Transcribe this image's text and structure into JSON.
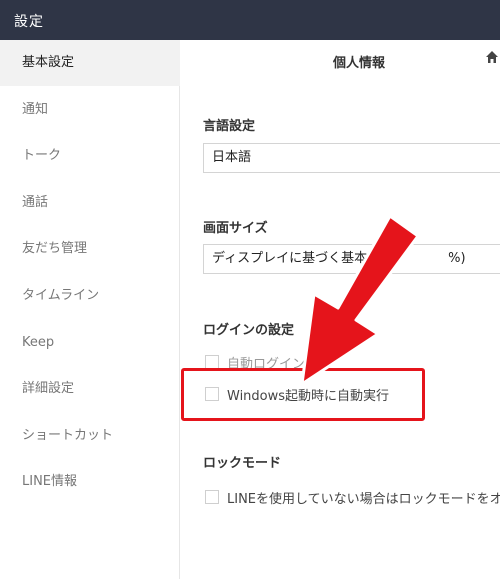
{
  "window": {
    "title": "設定"
  },
  "sidebar": {
    "items": [
      {
        "label": "基本設定",
        "active": true
      },
      {
        "label": "通知"
      },
      {
        "label": "トーク"
      },
      {
        "label": "通話"
      },
      {
        "label": "友だち管理"
      },
      {
        "label": "タイムライン"
      },
      {
        "label": "Keep"
      },
      {
        "label": "詳細設定"
      },
      {
        "label": "ショートカット"
      },
      {
        "label": "LINE情報"
      }
    ]
  },
  "panel": {
    "title": "個人情報",
    "home_icon": "home-icon"
  },
  "language": {
    "label": "言語設定",
    "value": "日本語"
  },
  "screen_size": {
    "label": "画面サイズ",
    "value": "ディスプレイに基づく基本サ",
    "value_tail": "%)"
  },
  "login": {
    "label": "ログインの設定",
    "auto_login": "自動ログイン",
    "auto_start": "Windows起動時に自動実行"
  },
  "lock_mode": {
    "label": "ロックモード",
    "option": "LINEを使用していない場合はロックモードをオン"
  },
  "colors": {
    "titlebar": "#2f3546",
    "highlight": "#e5141b",
    "active_bg": "#f2f2f2"
  }
}
